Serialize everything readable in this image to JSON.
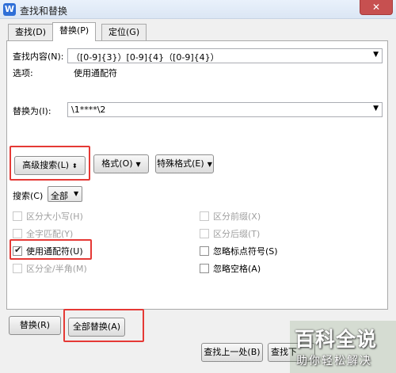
{
  "window": {
    "title": "查找和替换",
    "close": "✕",
    "app_icon": "W"
  },
  "tabs": [
    {
      "label": "查找(D)"
    },
    {
      "label": "替换(P)",
      "active": true
    },
    {
      "label": "定位(G)"
    }
  ],
  "find": {
    "label": "查找内容(N):",
    "value": "（[0-9]{3}）[0-9]{4}（[0-9]{4}）"
  },
  "options": {
    "label": "选项:",
    "value": "使用通配符"
  },
  "replace": {
    "label": "替换为(I):",
    "value": "\\1****\\2"
  },
  "buttons": {
    "advanced_search": "高级搜索(L)",
    "advanced_icon": "⬍",
    "format": "格式(O)",
    "special_format": "特殊格式(E)",
    "replace": "替换(R)",
    "replace_all": "全部替换(A)",
    "find_prev": "查找上一处(B)",
    "find_next": "查找下"
  },
  "search": {
    "label": "搜索(C)",
    "value": "全部"
  },
  "checkboxes": {
    "match_case": {
      "label": "区分大小写(H)",
      "checked": false,
      "disabled": true
    },
    "whole_word": {
      "label": "全字匹配(Y)",
      "checked": false,
      "disabled": true
    },
    "wildcards": {
      "label": "使用通配符(U)",
      "checked": true,
      "disabled": false
    },
    "full_half": {
      "label": "区分全/半角(M)",
      "checked": false,
      "disabled": true
    },
    "prefix": {
      "label": "区分前缀(X)",
      "checked": false,
      "disabled": true
    },
    "suffix": {
      "label": "区分后缀(T)",
      "checked": false,
      "disabled": true
    },
    "ignore_punct": {
      "label": "忽略标点符号(S)",
      "checked": false,
      "disabled": false
    },
    "ignore_space": {
      "label": "忽略空格(A)",
      "checked": false,
      "disabled": false
    }
  },
  "watermark": {
    "big": "百科全说",
    "small": "助你轻松解决"
  },
  "colors": {
    "highlight": "#e53935",
    "close": "#c75050"
  }
}
